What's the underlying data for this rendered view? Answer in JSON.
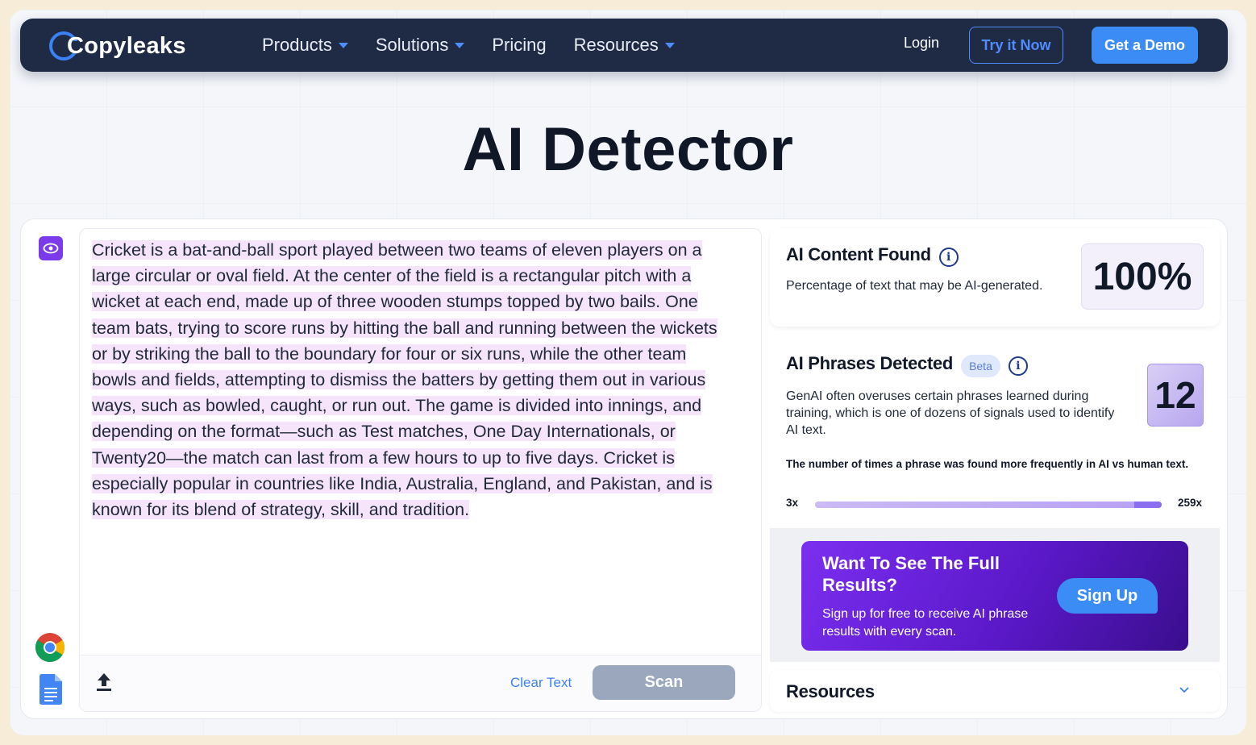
{
  "nav": {
    "logo": "Copyleaks",
    "menu": [
      {
        "label": "Products",
        "has_dropdown": true
      },
      {
        "label": "Solutions",
        "has_dropdown": true
      },
      {
        "label": "Pricing",
        "has_dropdown": false
      },
      {
        "label": "Resources",
        "has_dropdown": true
      }
    ],
    "login": "Login",
    "try_now": "Try it Now",
    "get_demo": "Get a Demo"
  },
  "page": {
    "title": "AI Detector"
  },
  "editor": {
    "lines": [
      "Cricket is a bat-and-ball sport played between two teams of eleven players on a",
      "large circular or oval field. At the center of the field is a rectangular pitch with a",
      "wicket at each end, made up of three wooden stumps topped by two bails. One",
      "team bats, trying to score runs by hitting the ball and running between the wickets",
      "or by striking the ball to the boundary for four or six runs, while the other team",
      "bowls and fields, attempting to dismiss the batters by getting them out in various",
      "ways, such as bowled, caught, or run out. The game is divided into innings, and",
      "depending on the format—such as Test matches, One Day Internationals, or",
      "Twenty20—the match can last from a few hours to up to five days. Cricket is",
      "especially popular in countries like India, Australia, England, and Pakistan, and is",
      "known for its blend of strategy, skill, and tradition."
    ],
    "clear_text": "Clear Text",
    "scan": "Scan"
  },
  "results": {
    "ai_content": {
      "title": "AI Content Found",
      "description": "Percentage of text that may be AI-generated.",
      "percentage": "100%"
    },
    "ai_phrases": {
      "title": "AI Phrases Detected",
      "badge": "Beta",
      "description": "GenAI often overuses certain phrases learned during training, which is one of dozens of signals used to identify AI text.",
      "count": "12",
      "frequency_label": "The number of times a phrase was found more frequently in AI vs human text.",
      "range_min": "3x",
      "range_max": "259x"
    },
    "promo": {
      "title": "Want To See The Full Results?",
      "subtitle": "Sign up for free to receive AI phrase results with every scan.",
      "button": "Sign Up"
    },
    "resources": "Resources"
  },
  "colors": {
    "nav_bg": "#1f2a44",
    "accent_blue": "#3b8df5",
    "highlight": "#f6e4fb",
    "purple": "#7c3aed"
  }
}
